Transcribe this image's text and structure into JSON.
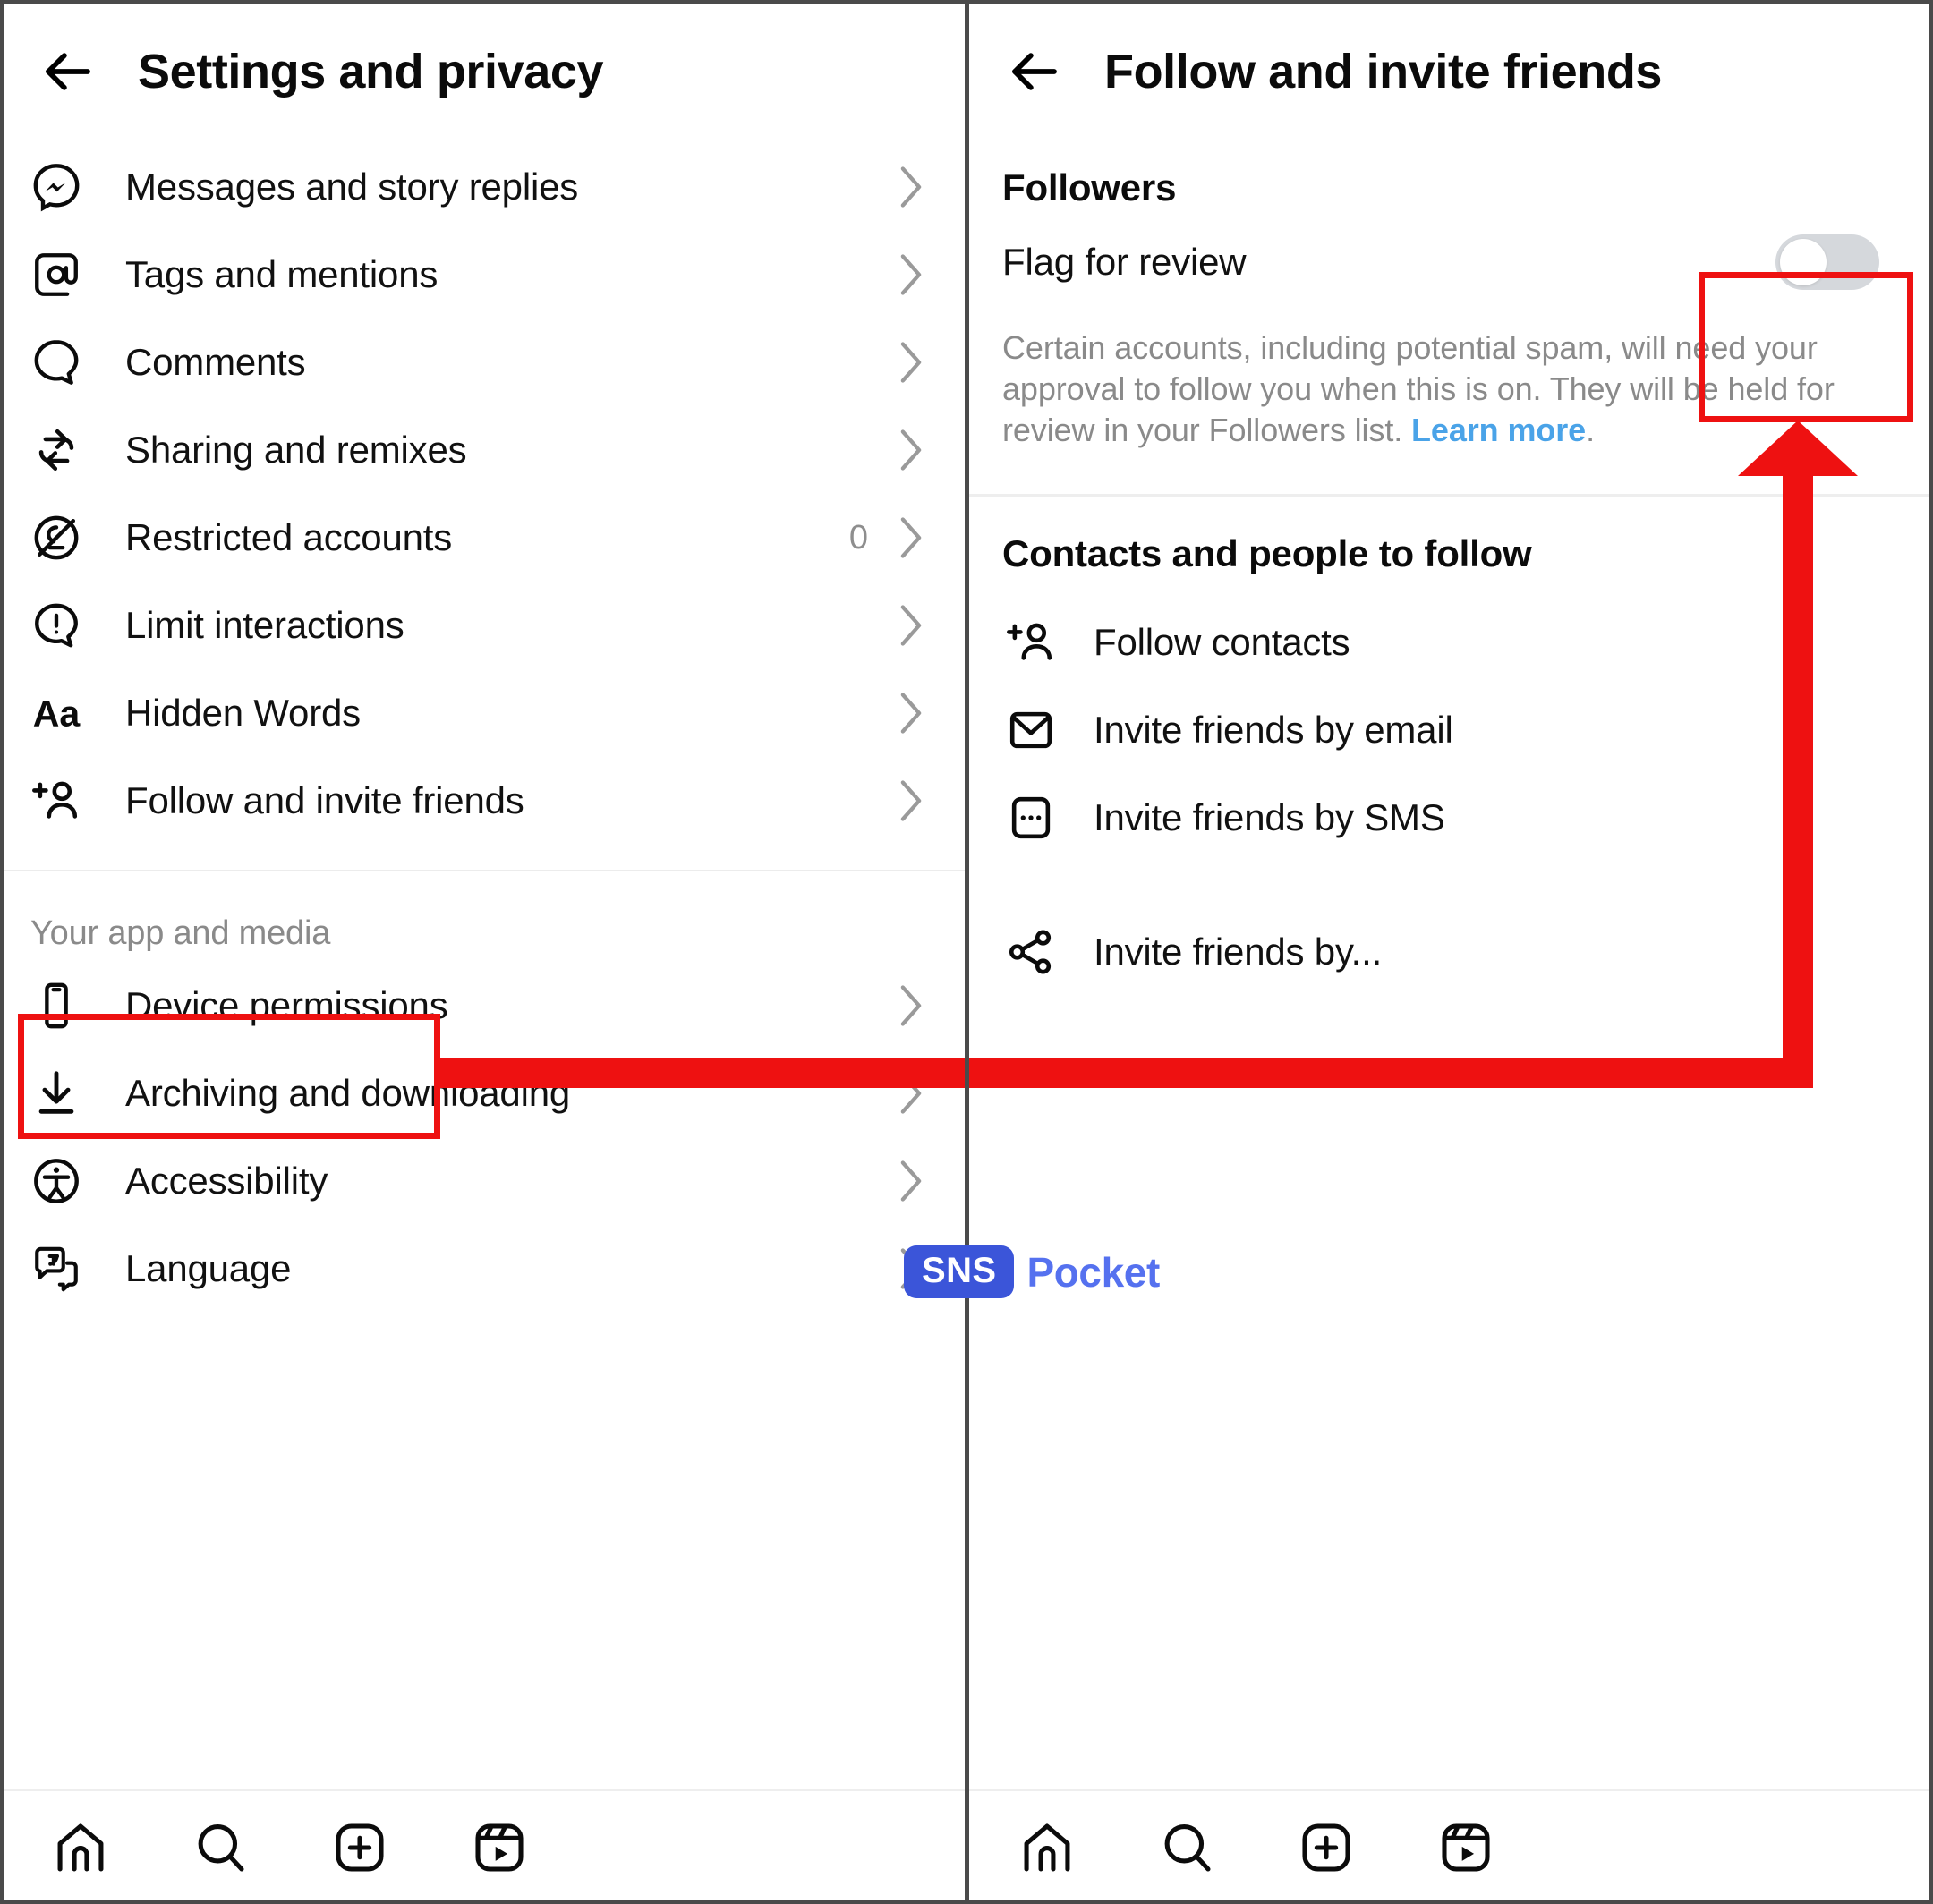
{
  "left_panel": {
    "header": {
      "back_icon": "back-arrow-icon",
      "title": "Settings and privacy"
    },
    "items": [
      {
        "icon": "messenger-icon",
        "label": "Messages and story replies",
        "count": "",
        "chevron": "chevron-right-icon"
      },
      {
        "icon": "at-mention-icon",
        "label": "Tags and mentions",
        "count": "",
        "chevron": "chevron-right-icon"
      },
      {
        "icon": "comment-icon",
        "label": "Comments",
        "count": "",
        "chevron": "chevron-right-icon"
      },
      {
        "icon": "remix-icon",
        "label": "Sharing and remixes",
        "count": "",
        "chevron": "chevron-right-icon"
      },
      {
        "icon": "restricted-icon",
        "label": "Restricted accounts",
        "count": "0",
        "chevron": "chevron-right-icon"
      },
      {
        "icon": "limit-icon",
        "label": "Limit interactions",
        "count": "",
        "chevron": "chevron-right-icon"
      },
      {
        "icon": "hidden-words-icon",
        "label": "Hidden Words",
        "count": "",
        "chevron": "chevron-right-icon"
      },
      {
        "icon": "add-person-icon",
        "label": "Follow and invite friends",
        "count": "",
        "chevron": "chevron-right-icon"
      }
    ],
    "section_title": "Your app and media",
    "items2": [
      {
        "icon": "device-icon",
        "label": "Device permissions",
        "count": "",
        "chevron": "chevron-right-icon"
      },
      {
        "icon": "download-icon",
        "label": "Archiving and downloading",
        "count": "",
        "chevron": "chevron-right-icon"
      },
      {
        "icon": "accessibility-icon",
        "label": "Accessibility",
        "count": "",
        "chevron": "chevron-right-icon"
      },
      {
        "icon": "language-icon",
        "label": "Language",
        "count": "",
        "chevron": "chevron-right-icon"
      }
    ],
    "bottom_nav": [
      {
        "icon": "home-icon",
        "name": "home"
      },
      {
        "icon": "search-icon",
        "name": "search"
      },
      {
        "icon": "create-icon",
        "name": "create"
      },
      {
        "icon": "reels-icon",
        "name": "reels"
      }
    ]
  },
  "right_panel": {
    "header": {
      "back_icon": "back-arrow-icon",
      "title": "Follow and invite friends"
    },
    "followers_heading": "Followers",
    "flag_row": {
      "label": "Flag for review",
      "state": "off"
    },
    "helper_text_part1": "Certain accounts, including potential spam, will need your approval to follow you when this is on. They will be held for review in your Followers list. ",
    "helper_link": "Learn more",
    "helper_text_part2": ".",
    "contacts_heading": "Contacts and people to follow",
    "items": [
      {
        "icon": "add-person-icon",
        "label": "Follow contacts"
      },
      {
        "icon": "email-icon",
        "label": "Invite friends by email"
      },
      {
        "icon": "sms-icon",
        "label": "Invite friends by SMS"
      },
      {
        "icon": "share-icon",
        "label": "Invite friends by..."
      }
    ],
    "bottom_nav": [
      {
        "icon": "home-icon",
        "name": "home"
      },
      {
        "icon": "search-icon",
        "name": "search"
      },
      {
        "icon": "create-icon",
        "name": "create"
      },
      {
        "icon": "reels-icon",
        "name": "reels"
      }
    ]
  },
  "annotations": {
    "highlight_color": "#ee1111",
    "highlight_left_label": "Follow and invite friends",
    "highlight_right_label": "Flag for review toggle"
  },
  "watermark": {
    "badge": "SNS",
    "text": "Pocket",
    "badge_color": "#3b55d9",
    "text_color": "#5571ef"
  }
}
